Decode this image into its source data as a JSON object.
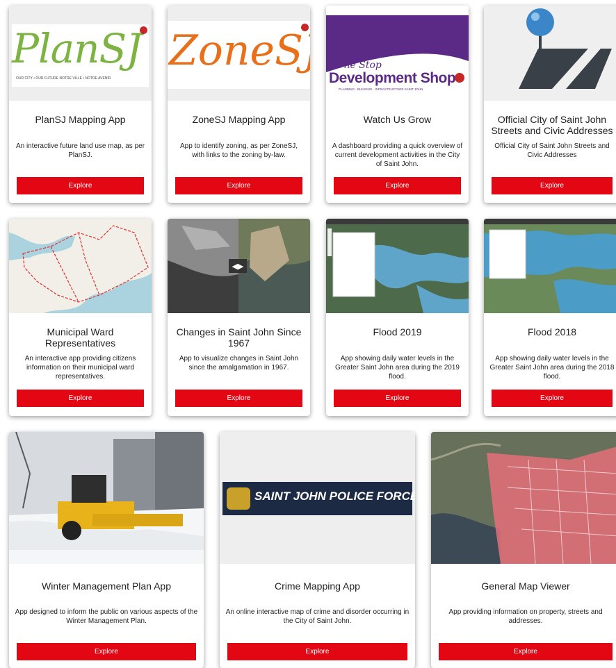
{
  "cards": [
    {
      "title": "PlanSJ Mapping App",
      "desc": "An interactive future land use map, as per PlanSJ.",
      "button": "Explore",
      "logo_main": "PlanSJ",
      "logo_sub": "OUR CITY • OUR FUTURE   NOTRE VILLE • NOTRE AVENIR"
    },
    {
      "title": "ZoneSJ Mapping App",
      "desc": "App to identify zoning, as per ZoneSJ, with links to the zoning by-law.",
      "button": "Explore",
      "logo_main": "ZoneSJ"
    },
    {
      "title": "Watch Us Grow",
      "desc": "A dashboard providing a quick overview of current development activities in the City of Saint John.",
      "button": "Explore",
      "logo_top": "One Stop",
      "logo_main": "Development Shop",
      "logo_sub": "PLANNING · BUILDING · INFRASTRUCTURE   SAINT JOHN"
    },
    {
      "title": "Official City of Saint John Streets and Civic Addresses",
      "desc": "Official City of Saint John Streets and Civic Addresses",
      "button": "Explore"
    },
    {
      "title": "Municipal Ward Representatives",
      "desc": "An interactive app providing citizens information on their municipal ward representatives.",
      "button": "Explore"
    },
    {
      "title": "Changes in Saint John Since 1967",
      "desc": "App to visualize changes in Saint John since the amalgamation in 1967.",
      "button": "Explore"
    },
    {
      "title": "Flood 2019",
      "desc": "App showing daily water levels in the Greater Saint John area during the 2019 flood.",
      "button": "Explore"
    },
    {
      "title": "Flood 2018",
      "desc": "App showing daily water levels in the Greater Saint John area during the 2018 flood.",
      "button": "Explore"
    },
    {
      "title": "Winter Management Plan App",
      "desc": "App designed to inform the public on various aspects of the Winter Management Plan.",
      "button": "Explore"
    },
    {
      "title": "Crime Mapping App",
      "desc": "An online interactive map of crime and disorder occurring in the City of Saint John.",
      "button": "Explore",
      "logo_main": "SAINT JOHN POLICE FORCE"
    },
    {
      "title": "General Map Viewer",
      "desc": "App providing information on property, streets and addresses.",
      "button": "Explore"
    }
  ],
  "colors": {
    "accent": "#e30613",
    "pin": "#3b86c8",
    "map_dark": "#3a4047"
  }
}
